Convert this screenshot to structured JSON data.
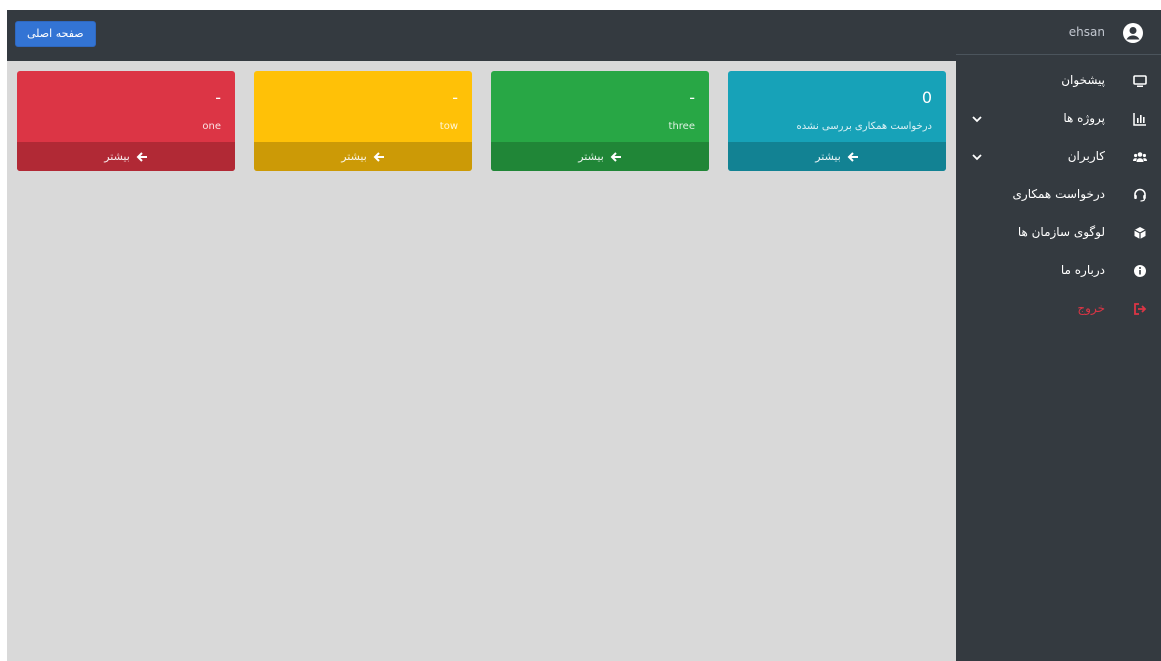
{
  "header": {
    "home_button": "صفحه اصلی"
  },
  "user": {
    "name": "ehsan"
  },
  "sidebar": {
    "items": [
      {
        "label": "پیشخوان",
        "icon": "desktop-icon"
      },
      {
        "label": "پروژه ها",
        "icon": "chart-icon",
        "expandable": true
      },
      {
        "label": "کاربران",
        "icon": "users-icon",
        "expandable": true
      },
      {
        "label": "درخواست همکاری",
        "icon": "headset-icon"
      },
      {
        "label": "لوگوی سازمان ها",
        "icon": "cube-icon"
      },
      {
        "label": "درباره ما",
        "icon": "info-icon"
      },
      {
        "label": "خروج",
        "icon": "logout-icon",
        "color": "#dc3545"
      }
    ]
  },
  "cards": [
    {
      "value": "0",
      "label": "درخواست همکاری بررسی نشده",
      "footer": "بیشتر",
      "color": "#17a2b8"
    },
    {
      "value": "-",
      "label": "three",
      "footer": "بیشتر",
      "color": "#28a745"
    },
    {
      "value": "-",
      "label": "tow",
      "footer": "بیشتر",
      "color": "#ffc107"
    },
    {
      "value": "-",
      "label": "one",
      "footer": "بیشتر",
      "color": "#dc3545"
    }
  ]
}
